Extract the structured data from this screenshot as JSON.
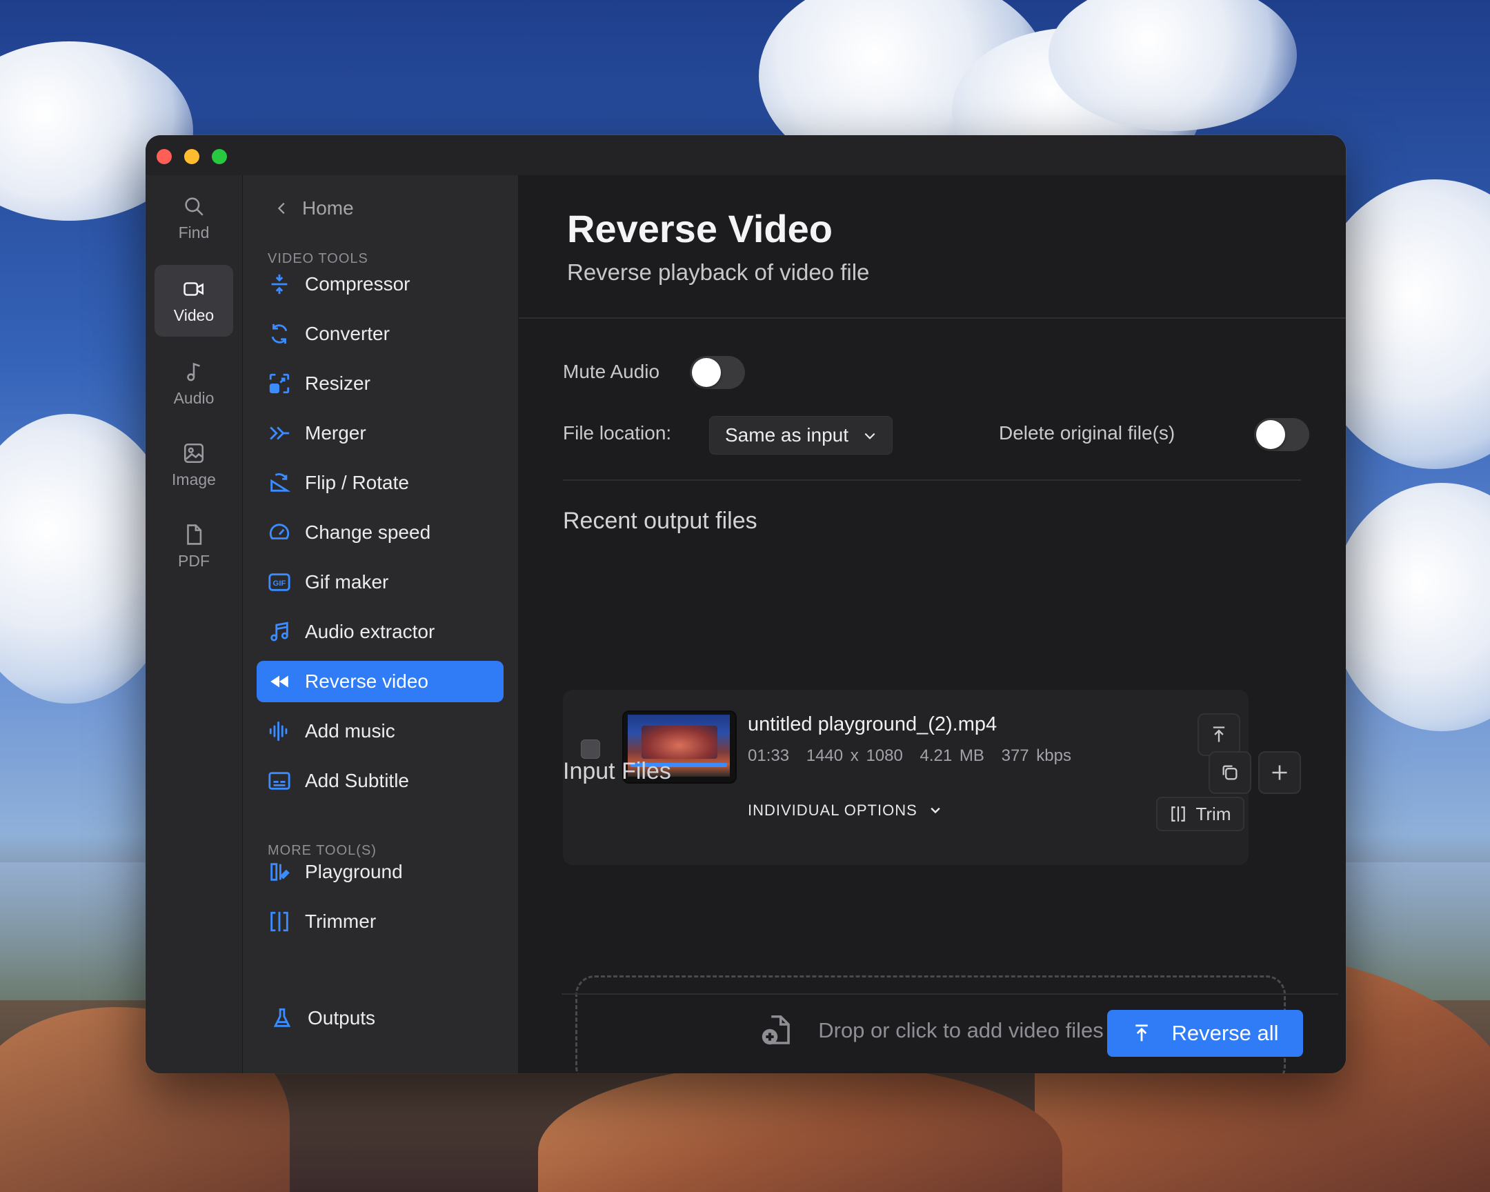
{
  "window": {
    "traffic_lights": {
      "close": "#ff5f57",
      "minimize": "#febc2e",
      "zoom": "#28c840"
    }
  },
  "rail": {
    "items": [
      {
        "label": "Find",
        "icon": "search-icon"
      },
      {
        "label": "Video",
        "icon": "video-camera-icon",
        "active": true
      },
      {
        "label": "Audio",
        "icon": "music-note-icon"
      },
      {
        "label": "Image",
        "icon": "image-icon"
      },
      {
        "label": "PDF",
        "icon": "document-icon"
      }
    ]
  },
  "nav": {
    "back_label": "Home",
    "section_video": "VIDEO TOOLS",
    "section_more": "MORE TOOL(S)",
    "items": [
      {
        "label": "Compressor",
        "icon": "compress-icon"
      },
      {
        "label": "Converter",
        "icon": "convert-icon"
      },
      {
        "label": "Resizer",
        "icon": "resize-icon"
      },
      {
        "label": "Merger",
        "icon": "merge-icon"
      },
      {
        "label": "Flip / Rotate",
        "icon": "rotate-icon"
      },
      {
        "label": "Change speed",
        "icon": "speedometer-icon"
      },
      {
        "label": "Gif maker",
        "icon": "gif-icon"
      },
      {
        "label": "Audio extractor",
        "icon": "music-note-icon"
      },
      {
        "label": "Reverse video",
        "icon": "rewind-icon",
        "active": true
      },
      {
        "label": "Add music",
        "icon": "waveform-icon"
      },
      {
        "label": "Add Subtitle",
        "icon": "subtitle-icon"
      }
    ],
    "more_items": [
      {
        "label": "Playground",
        "icon": "playground-icon"
      },
      {
        "label": "Trimmer",
        "icon": "trim-icon"
      }
    ],
    "outputs_label": "Outputs"
  },
  "main": {
    "title": "Reverse Video",
    "subtitle": "Reverse playback of video file",
    "mute_audio_label": "Mute Audio",
    "mute_audio_on": false,
    "file_location_label": "File location:",
    "file_location_value": "Same as input",
    "delete_original_label": "Delete original file(s)",
    "delete_original_on": false,
    "recent_heading": "Recent output files",
    "recent_file": {
      "name": "untitled playground_(2).mp4",
      "duration": "01:33",
      "resolution": "1440 x 1080",
      "size": "4.21 MB",
      "bitrate": "377 kbps",
      "options_label": "INDIVIDUAL OPTIONS",
      "trim_label": "Trim"
    },
    "input_heading": "Input Files",
    "dropzone_text": "Drop or click to add video files",
    "primary_label": "Reverse all",
    "accent": "#2f7cf6"
  }
}
